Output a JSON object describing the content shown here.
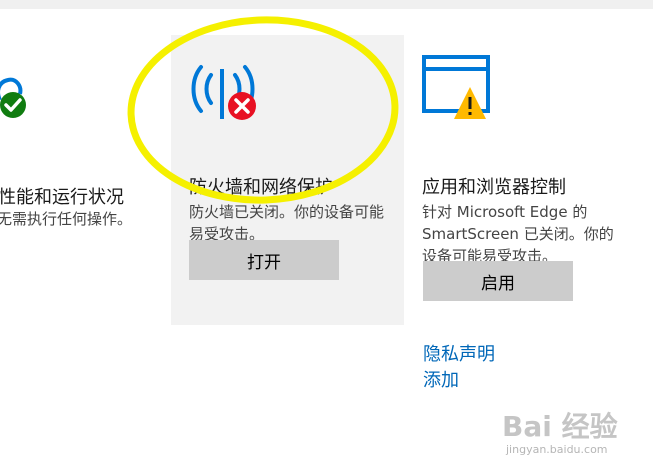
{
  "cards": {
    "health": {
      "title": "性能和运行状况",
      "desc": "无需执行任何操作。",
      "icon": "heart-check-icon"
    },
    "firewall": {
      "title": "防火墙和网络保护",
      "desc": "防火墙已关闭。你的设备可能易受攻击。",
      "button_label": "打开",
      "icon": "firewall-error-icon"
    },
    "app_browser": {
      "title": "应用和浏览器控制",
      "desc": "针对 Microsoft Edge 的 SmartScreen 已关闭。你的设备可能易受攻击。",
      "button_label": "启用",
      "icon": "browser-warning-icon"
    }
  },
  "links": {
    "privacy": "隐私声明",
    "add": "添加"
  },
  "watermark": {
    "logo": "Bai 经验",
    "url": "jingyan.baidu.com"
  },
  "colors": {
    "accent_blue": "#0078d7",
    "link_blue": "#0067b8",
    "error_red": "#e81123",
    "ok_green": "#107c10",
    "warning_yellow": "#ffb900",
    "annotation_yellow": "#f5f000",
    "card_highlight_bg": "#f2f2f2",
    "button_bg": "#cccccc"
  }
}
